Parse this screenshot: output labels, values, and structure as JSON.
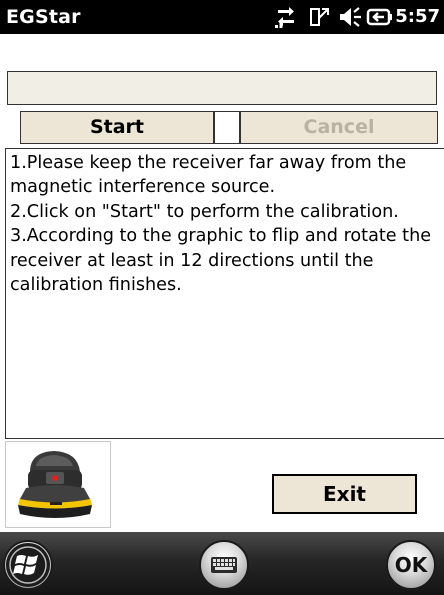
{
  "statusbar": {
    "app_title": "EGStar",
    "clock": "5:57",
    "icons": [
      "data-transfer-icon",
      "signal-icon",
      "speaker-icon",
      "battery-charging-icon"
    ]
  },
  "dialog": {
    "message_value": "",
    "start_label": "Start",
    "cancel_label": "Cancel",
    "instructions": [
      "1.Please keep the receiver far away from the magnetic interference source.",
      "2.Click on \"Start\" to perform the calibration.",
      "3.According to the graphic to flip and rotate the receiver at least in 12 directions until the calibration finishes."
    ],
    "receiver_image": "gnss-receiver-image",
    "exit_label": "Exit"
  },
  "bottombar": {
    "start_icon": "windows-logo-icon",
    "keyboard_icon": "keyboard-icon",
    "ok_label": "OK"
  },
  "colors": {
    "button_bg": "#ede6d6",
    "disabled_text": "#b9b2a2",
    "status_bar_bg": "#000000"
  }
}
